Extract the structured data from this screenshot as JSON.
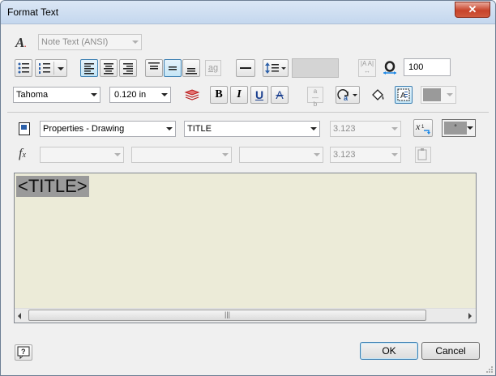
{
  "window": {
    "title": "Format Text"
  },
  "style": {
    "value": "Note Text (ANSI)"
  },
  "format": {
    "stretch_value": "100"
  },
  "font": {
    "name": "Tahoma",
    "size": "0.120 in"
  },
  "parameters": {
    "type": "Properties - Drawing",
    "property": "TITLE",
    "precision": "3.123",
    "precision2": "3.123"
  },
  "editor": {
    "content": "<TITLE>"
  },
  "buttons": {
    "ok": "OK",
    "cancel": "Cancel"
  },
  "colors": {
    "editor_bg": "#ecebd8",
    "highlight_bg": "#9a9a9a",
    "accent": "#3c7fb1"
  }
}
